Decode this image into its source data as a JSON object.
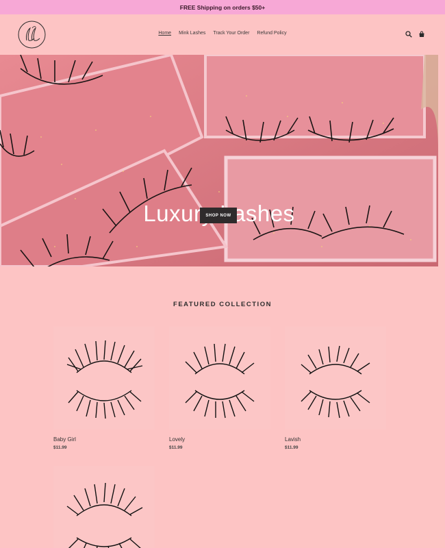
{
  "announcement": {
    "text": "FREE Shipping on orders $50+"
  },
  "header": {
    "logo_icon": "LL-monogram-logo",
    "nav": [
      {
        "label": "Home",
        "active": true
      },
      {
        "label": "Mink Lashes",
        "active": false
      },
      {
        "label": "Track Your Order",
        "active": false
      },
      {
        "label": "Refund Policy",
        "active": false
      }
    ],
    "icons": [
      "search-icon",
      "cart-icon"
    ]
  },
  "hero": {
    "title": "Luxury Lashes",
    "button_label": "SHOP NOW"
  },
  "featured": {
    "title": "FEATURED COLLECTION",
    "products": [
      {
        "name": "Baby Girl",
        "price": "$11.99"
      },
      {
        "name": "Lovely",
        "price": "$11.99"
      },
      {
        "name": "Lavish",
        "price": "$11.99"
      },
      {
        "name": "",
        "price": ""
      }
    ]
  },
  "colors": {
    "background": "#fdc4c4",
    "announcement_bg": "#f7a8d6",
    "button_bg": "#2f2b2c"
  }
}
